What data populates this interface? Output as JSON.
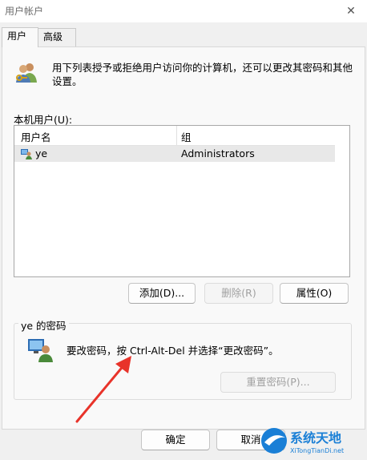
{
  "window": {
    "title": "用户帐户"
  },
  "tabs": [
    {
      "label": "用户"
    },
    {
      "label": "高级"
    }
  ],
  "intro": {
    "line1": "用下列表授予或拒绝用户访问你的计算机，还可以更改其密码和其他",
    "line2": "设置。"
  },
  "users_label": "本机用户(U):",
  "table": {
    "headers": [
      "用户名",
      "组"
    ],
    "rows": [
      {
        "username": "ye",
        "group": "Administrators"
      }
    ]
  },
  "list_buttons": {
    "add": "添加(D)...",
    "remove": "删除(R)",
    "properties": "属性(O)"
  },
  "password_group": {
    "title": "ye 的密码",
    "message": "要改密码，按 Ctrl-Alt-Del 并选择“更改密码”。",
    "reset": "重置密码(P)..."
  },
  "footer": {
    "ok": "确定",
    "cancel": "取消"
  },
  "watermark": {
    "name": "系统天地",
    "site": "XiTongTianDi.net"
  },
  "colors": {
    "arrow": "#e8332a",
    "watermark_blue": "#1a7fd6"
  }
}
